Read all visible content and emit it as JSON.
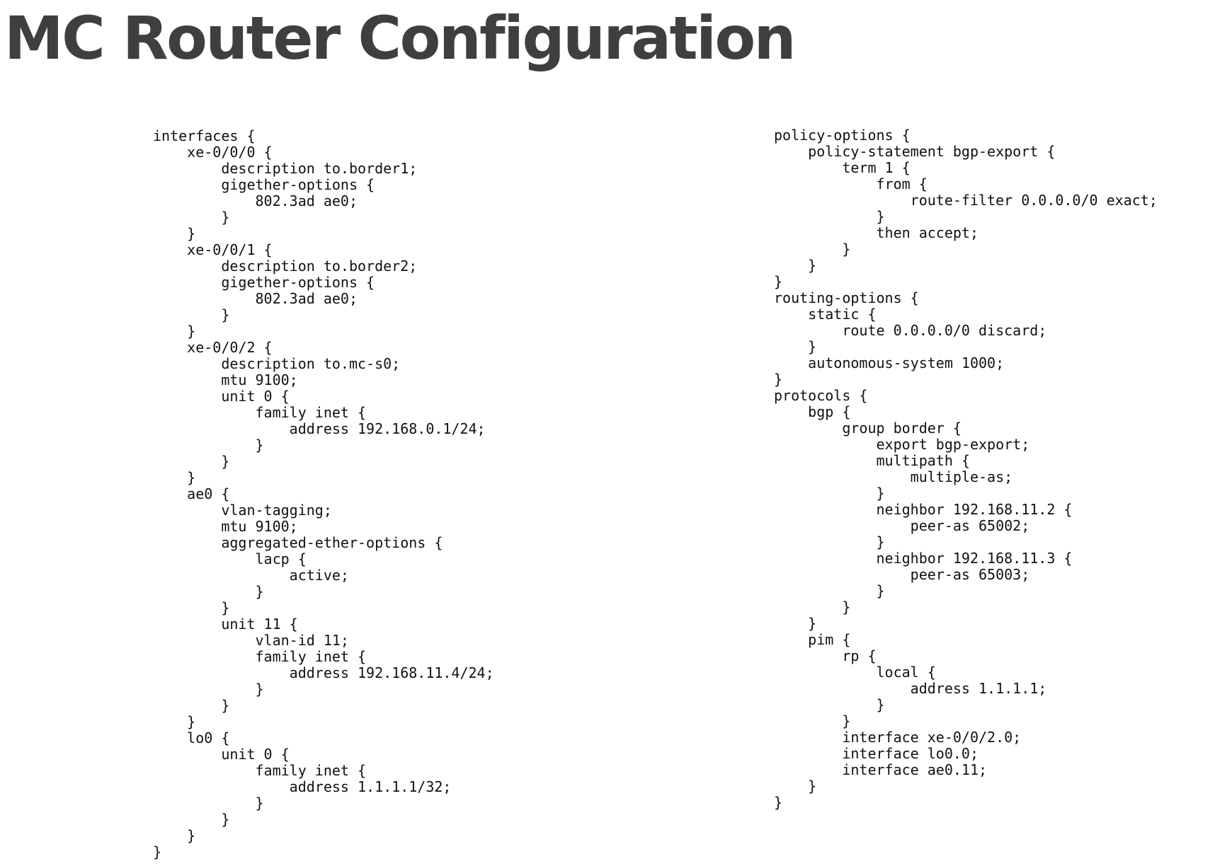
{
  "title": "MC Router Configuration",
  "config": {
    "left": [
      "interfaces {",
      "    xe-0/0/0 {",
      "        description to.border1;",
      "        gigether-options {",
      "            802.3ad ae0;",
      "        }",
      "    }",
      "    xe-0/0/1 {",
      "        description to.border2;",
      "        gigether-options {",
      "            802.3ad ae0;",
      "        }",
      "    }",
      "    xe-0/0/2 {",
      "        description to.mc-s0;",
      "        mtu 9100;",
      "        unit 0 {",
      "            family inet {",
      "                address 192.168.0.1/24;",
      "            }",
      "        }",
      "    }",
      "    ae0 {",
      "        vlan-tagging;",
      "        mtu 9100;",
      "        aggregated-ether-options {",
      "            lacp {",
      "                active;",
      "            }",
      "        }",
      "        unit 11 {",
      "            vlan-id 11;",
      "            family inet {",
      "                address 192.168.11.4/24;",
      "            }",
      "        }",
      "    }",
      "    lo0 {",
      "        unit 0 {",
      "            family inet {",
      "                address 1.1.1.1/32;",
      "            }",
      "        }",
      "    }",
      "}"
    ],
    "right": [
      "policy-options {",
      "    policy-statement bgp-export {",
      "        term 1 {",
      "            from {",
      "                route-filter 0.0.0.0/0 exact;",
      "            }",
      "            then accept;",
      "        }",
      "    }",
      "}",
      "routing-options {",
      "    static {",
      "        route 0.0.0.0/0 discard;",
      "    }",
      "    autonomous-system 1000;",
      "}",
      "protocols {",
      "    bgp {",
      "        group border {",
      "            export bgp-export;",
      "            multipath {",
      "                multiple-as;",
      "            }",
      "            neighbor 192.168.11.2 {",
      "                peer-as 65002;",
      "            }",
      "            neighbor 192.168.11.3 {",
      "                peer-as 65003;",
      "            }",
      "        }",
      "    }",
      "    pim {",
      "        rp {",
      "            local {",
      "                address 1.1.1.1;",
      "            }",
      "        }",
      "        interface xe-0/0/2.0;",
      "        interface lo0.0;",
      "        interface ae0.11;",
      "    }",
      "}"
    ]
  }
}
